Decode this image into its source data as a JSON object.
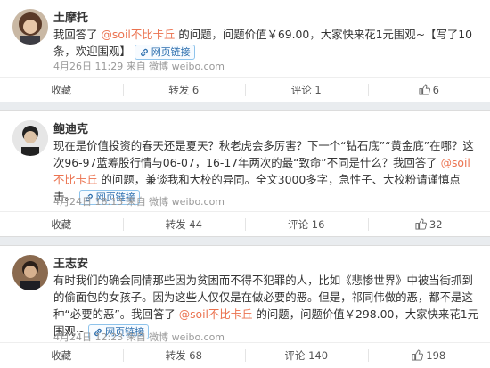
{
  "posts": [
    {
      "author": "土摩托",
      "text_before": "我回答了 ",
      "mention": "@soil不比卡丘",
      "text_after": " 的问题，问题价值￥69.00，大家快来花1元围观~【写了10条，欢迎围观】",
      "link_label": "网页链接",
      "meta": "4月26日 11:29 来自 微博 weibo.com",
      "fav": "收藏",
      "repost": "转发 6",
      "comment": "评论 1",
      "like": "6"
    },
    {
      "author": "鲍迪克",
      "text_before": "现在是价值投资的春天还是夏天？秋老虎会多厉害？下一个“钻石底”“黄金底”在哪？这次96-97蓝筹股行情与06-07，16-17年两次的最“致命”不同是什么？我回答了 ",
      "mention": "@soil不比卡丘",
      "text_after": " 的问题，兼谈我和大校的异同。全文3000多字，急性子、大校粉请谨慎点击。",
      "link_label": "网页链接",
      "meta": "4月24日 18:13 来自 微博 weibo.com",
      "fav": "收藏",
      "repost": "转发 44",
      "comment": "评论 16",
      "like": "32"
    },
    {
      "author": "王志安",
      "text_before": "有时我们的确会同情那些因为贫困而不得不犯罪的人，比如《悲惨世界》中被当街抓到的偷面包的女孩子。因为这些人仅仅是在做必要的恶。但是，祁同伟做的恶，都不是这种“必要的恶”。我回答了 ",
      "mention": "@soil不比卡丘",
      "text_after": " 的问题，问题价值￥298.00，大家快来花1元围观~",
      "link_label": "网页链接",
      "meta": "4月24日 12:23 来自 微博 weibo.com",
      "fav": "收藏",
      "repost": "转发 68",
      "comment": "评论 140",
      "like": "198"
    }
  ],
  "colors": {
    "mention": "#eb7350",
    "link": "#2d6fae",
    "meta": "#999999"
  },
  "icons": [
    "avatar",
    "link-chain-icon",
    "thumb-up-icon"
  ]
}
